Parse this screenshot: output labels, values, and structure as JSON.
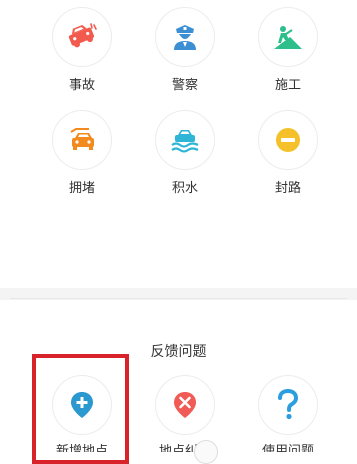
{
  "traffic_types": [
    {
      "label": "事故",
      "icon": "accident-car-icon",
      "color": "#f25a4e"
    },
    {
      "label": "警察",
      "icon": "police-icon",
      "color": "#3d8fd4"
    },
    {
      "label": "施工",
      "icon": "construction-icon",
      "color": "#2dbf8b"
    },
    {
      "label": "拥堵",
      "icon": "congestion-car-icon",
      "color": "#f28a1e"
    },
    {
      "label": "积水",
      "icon": "waterlogging-car-icon",
      "color": "#2fb6d7"
    },
    {
      "label": "封路",
      "icon": "road-closed-icon",
      "color": "#f5c12b"
    }
  ],
  "feedback": {
    "title": "反馈问题",
    "items": [
      {
        "label": "新增地点",
        "icon": "add-location-icon",
        "color": "#2b98cf"
      },
      {
        "label": "地点纠错",
        "icon": "location-error-icon",
        "color": "#f05b55"
      },
      {
        "label": "使用问题",
        "icon": "question-icon",
        "color": "#2b9ee0"
      }
    ]
  },
  "colors": {
    "highlight_border": "#d8232a"
  }
}
